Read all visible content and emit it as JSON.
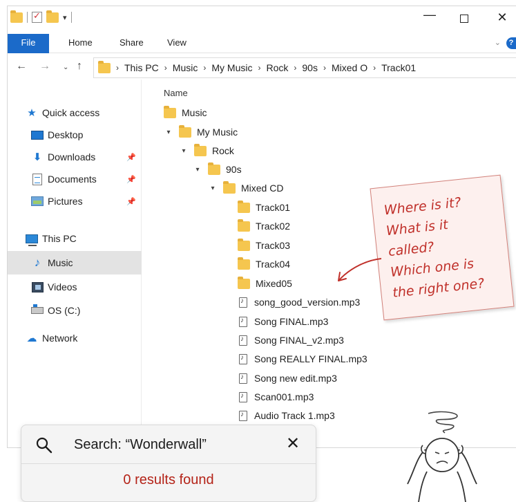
{
  "ribbon": {
    "file": "File",
    "home": "Home",
    "share": "Share",
    "view": "View"
  },
  "window_controls": {
    "minimize": "—",
    "close": "✕"
  },
  "address_bar": {
    "crumbs": [
      "This PC",
      "Music",
      "My Music",
      "Rock",
      "90s",
      "Mixed O",
      "Track01"
    ]
  },
  "sidebar": {
    "items": [
      {
        "label": "Quick access",
        "icon": "star-icon"
      },
      {
        "label": "Desktop",
        "icon": "desktop-icon"
      },
      {
        "label": "Downloads",
        "icon": "download-icon"
      },
      {
        "label": "Documents",
        "icon": "documents-icon"
      },
      {
        "label": "Pictures",
        "icon": "pictures-icon"
      },
      {
        "label": "This PC",
        "icon": "computer-icon"
      },
      {
        "label": "Music",
        "icon": "music-icon"
      },
      {
        "label": "Videos",
        "icon": "videos-icon"
      },
      {
        "label": "OS (C:)",
        "icon": "drive-icon"
      },
      {
        "label": "Network",
        "icon": "network-icon"
      }
    ],
    "active": "Music"
  },
  "tree": {
    "header": "Name",
    "folders": [
      "Music",
      "My Music",
      "Rock",
      "90s",
      "Mixed CD",
      "Track01",
      "Track02",
      "Track03",
      "Track04",
      "Mixed05"
    ],
    "files": [
      "song_good_version.mp3",
      "Song FINAL.mp3",
      "Song FINAL_v2.mp3",
      "Song REALLY FINAL.mp3",
      "Song new edit.mp3",
      "Scan001.mp3",
      "Audio Track 1.mp3"
    ]
  },
  "note": {
    "lines": [
      "Where is it?",
      "What is it",
      "called?",
      "Which one is",
      "the right one?"
    ],
    "color": "#c0302a"
  },
  "search_toast": {
    "query": "Search: “Wonderwall”",
    "close": "✕",
    "result": "0 results found"
  },
  "colors": {
    "accent": "#1b6ac9",
    "folder": "#f5c64f",
    "error": "#b42318"
  }
}
